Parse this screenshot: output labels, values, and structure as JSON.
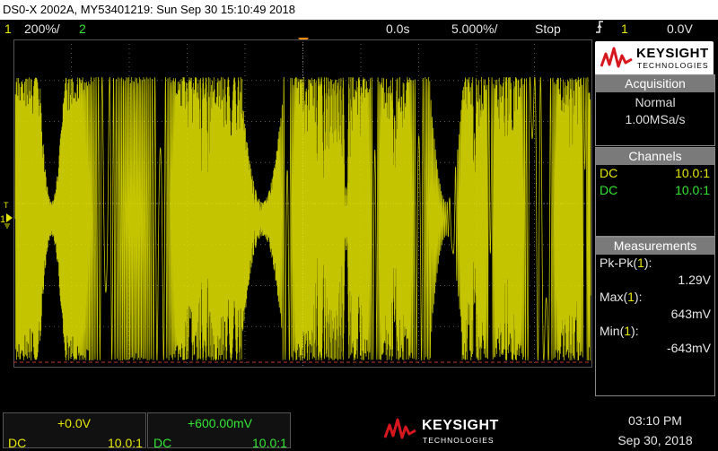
{
  "title": "DS0-X 2002A, MY53401219: Sun Sep 30 15:10:49 2018",
  "topbar": {
    "ch1_num": "1",
    "ch1_scale": "200%/",
    "ch2_num": "2",
    "time_pos": "0.0s",
    "time_scale": "5.000%/",
    "run_state": "Stop",
    "trigger_icon": "rising-edge-icon",
    "trigger_src": "1",
    "trigger_level": "0.0V"
  },
  "brand": {
    "name": "KEYSIGHT",
    "sub": "TECHNOLOGIES",
    "color": "#d6171e"
  },
  "acquisition": {
    "header": "Acquisition",
    "mode": "Normal",
    "rate": "1.00MSa/s"
  },
  "channels": {
    "header": "Channels",
    "items": [
      {
        "coupling": "DC",
        "probe": "10.0:1",
        "color": "#e6e600"
      },
      {
        "coupling": "DC",
        "probe": "10.0:1",
        "color": "#33e633"
      }
    ]
  },
  "measurements": {
    "header": "Measurements",
    "items": [
      {
        "label": "Pk-Pk",
        "ch": "1",
        "value": "1.29V"
      },
      {
        "label": "Max",
        "ch": "1",
        "value": "643mV"
      },
      {
        "label": "Min",
        "ch": "1",
        "value": "-643mV"
      }
    ]
  },
  "bottom": {
    "ch1": {
      "offset": "+0.0V",
      "coupling": "DC",
      "probe": "10.0:1"
    },
    "ch2": {
      "offset": "+600.00mV",
      "coupling": "DC",
      "probe": "10.0:1"
    },
    "time": "03:10 PM",
    "date": "Sep 30, 2018"
  },
  "colors": {
    "ch1": "#e6e600",
    "ch2": "#33e633",
    "marker": "#ff8c00",
    "grid": "#5a5a5a"
  }
}
